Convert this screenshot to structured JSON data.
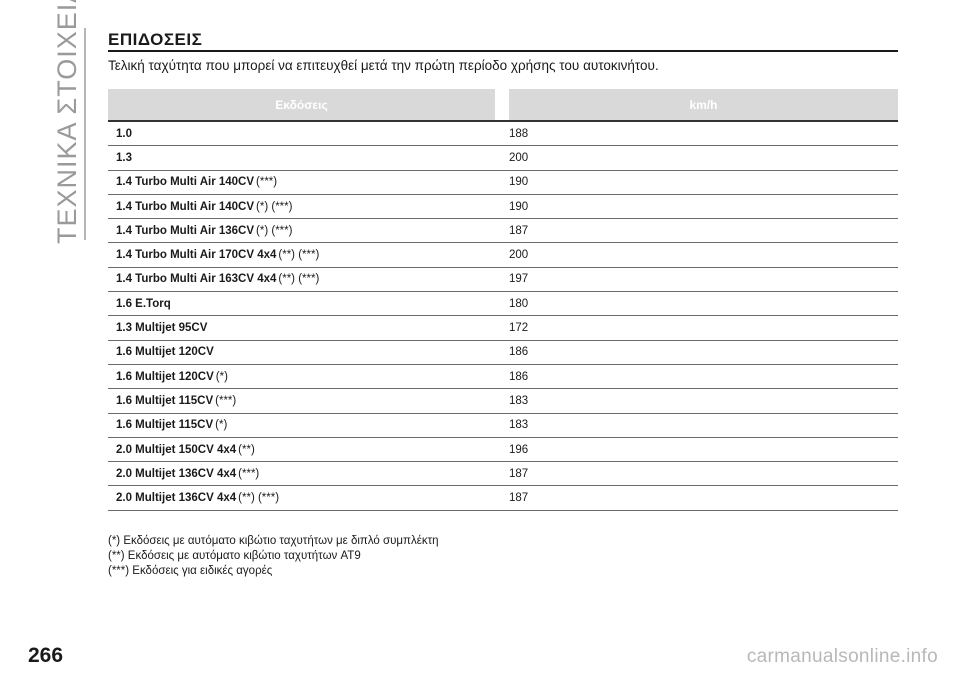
{
  "sidebar": {
    "title": "ΤΕΧΝΙΚΑ ΣΤΟΙΧΕΙΑ"
  },
  "section": {
    "title": "ΕΠΙΔΟΣΕΙΣ",
    "subtitle": "Τελική ταχύτητα που μπορεί να επιτευχθεί μετά την πρώτη περίοδο χρήσης του αυτοκινήτου."
  },
  "table": {
    "headers": [
      "Εκδόσεις",
      "km/h"
    ],
    "rows": [
      {
        "name": "1.0",
        "note": "",
        "kmh": "188"
      },
      {
        "name": "1.3",
        "note": "",
        "kmh": "200"
      },
      {
        "name": "1.4 Turbo Multi Air 140CV",
        "note": "(***)",
        "kmh": "190"
      },
      {
        "name": "1.4 Turbo Multi Air 140CV",
        "note": "(*) (***)",
        "kmh": "190"
      },
      {
        "name": "1.4 Turbo Multi Air 136CV",
        "note": "(*) (***)",
        "kmh": "187"
      },
      {
        "name": "1.4 Turbo Multi Air 170CV 4x4",
        "note": "(**) (***)",
        "kmh": "200"
      },
      {
        "name": "1.4 Turbo Multi Air 163CV 4x4",
        "note": "(**) (***)",
        "kmh": "197"
      },
      {
        "name": "1.6 E.Torq",
        "note": "",
        "kmh": "180"
      },
      {
        "name": "1.3 Multijet 95CV",
        "note": "",
        "kmh": "172"
      },
      {
        "name": "1.6 Multijet 120CV",
        "note": "",
        "kmh": "186"
      },
      {
        "name": "1.6 Multijet 120CV",
        "note": "(*)",
        "kmh": "186"
      },
      {
        "name": "1.6 Multijet 115CV",
        "note": "(***)",
        "kmh": "183"
      },
      {
        "name": "1.6 Multijet 115CV",
        "note": "(*)",
        "kmh": "183"
      },
      {
        "name": "2.0 Multijet 150CV 4x4",
        "note": "(**)",
        "kmh": "196"
      },
      {
        "name": "2.0 Multijet 136CV 4x4",
        "note": "(***)",
        "kmh": "187"
      },
      {
        "name": "2.0 Multijet 136CV 4x4",
        "note": "(**) (***)",
        "kmh": "187"
      }
    ]
  },
  "footnotes": [
    "(*) Εκδόσεις με αυτόματο κιβώτιο ταχυτήτων με διπλό συμπλέκτη",
    "(**) Εκδόσεις με αυτόματο κιβώτιο ταχυτήτων AT9",
    "(***) Εκδόσεις για ειδικές αγορές"
  ],
  "page_number": "266",
  "watermark": "carmanualsonline.info"
}
